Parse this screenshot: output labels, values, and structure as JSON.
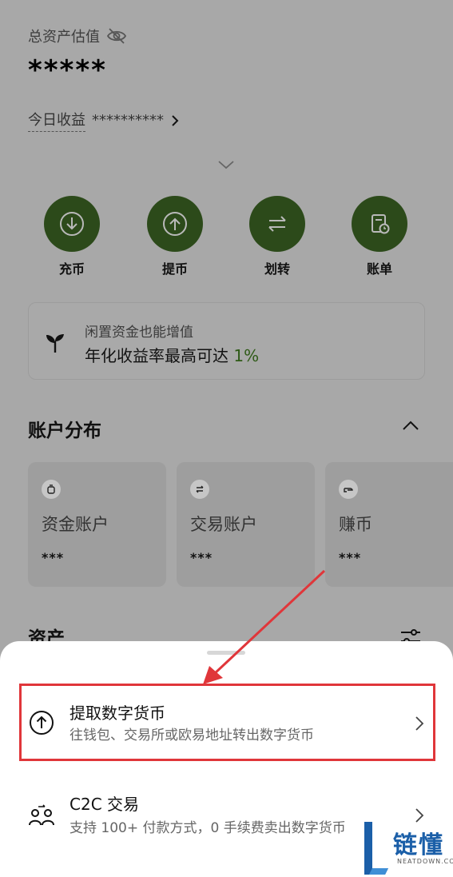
{
  "overview": {
    "asset_label": "总资产估值",
    "asset_value": "*****",
    "today_label": "今日收益",
    "today_value": "**********"
  },
  "actions": [
    {
      "label": "充币",
      "icon": "deposit-icon"
    },
    {
      "label": "提币",
      "icon": "withdraw-icon"
    },
    {
      "label": "划转",
      "icon": "transfer-icon"
    },
    {
      "label": "账单",
      "icon": "bill-icon"
    }
  ],
  "promo": {
    "line1": "闲置资金也能增值",
    "line2_prefix": "年化收益率最高可达 ",
    "line2_highlight": "1%"
  },
  "distribution": {
    "title": "账户分布",
    "cards": [
      {
        "name": "资金账户",
        "value": "***",
        "icon": "wallet-icon"
      },
      {
        "name": "交易账户",
        "value": "***",
        "icon": "exchange-icon"
      },
      {
        "name": "赚币",
        "value": "***",
        "icon": "earn-icon"
      }
    ]
  },
  "assets": {
    "title": "资产"
  },
  "sheet": {
    "options": [
      {
        "title": "提取数字货币",
        "subtitle": "往钱包、交易所或欧易地址转出数字货币",
        "icon": "upload-circle-icon"
      },
      {
        "title": "C2C 交易",
        "subtitle": "支持 100+ 付款方式，0 手续费卖出数字货币",
        "icon": "c2c-users-icon"
      }
    ]
  },
  "colors": {
    "accent_green": "#2c4a1a",
    "highlight_red": "#e0363a",
    "promo_green": "#2e5a16"
  },
  "watermark": {
    "text": "链懂",
    "sub": "NEATDOWN.COM"
  }
}
